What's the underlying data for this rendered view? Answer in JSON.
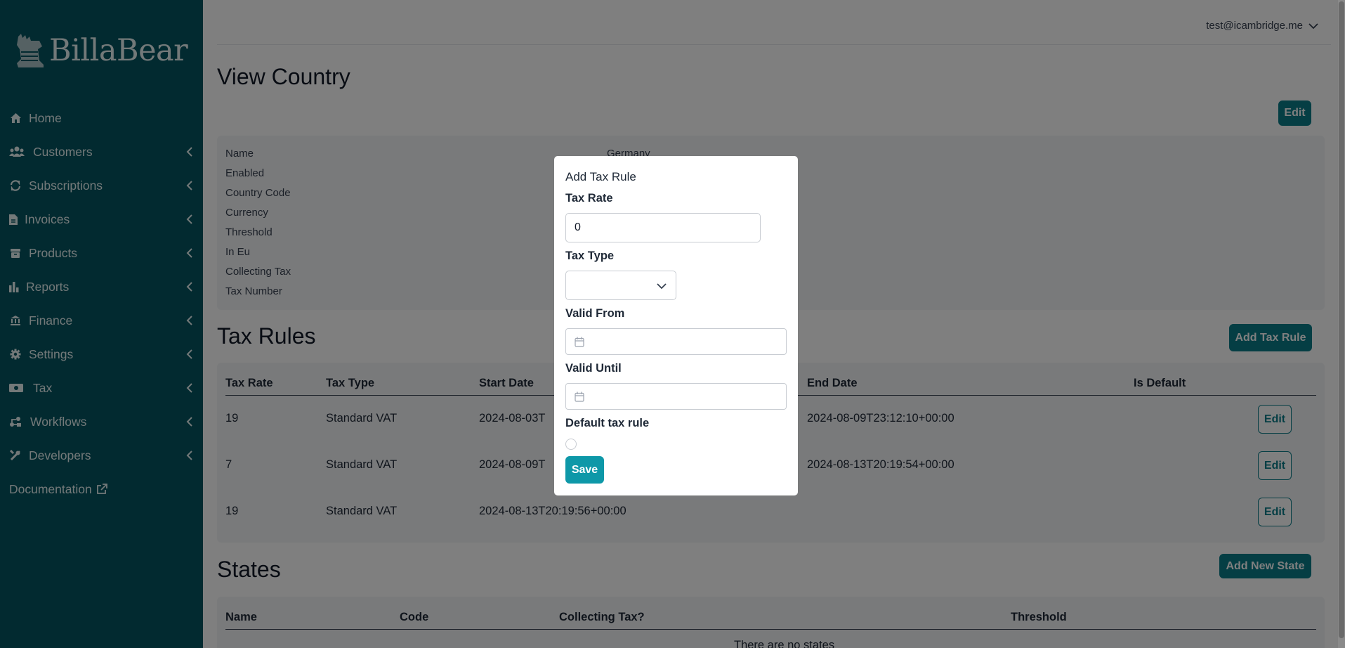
{
  "app": {
    "brand": "BillaBear"
  },
  "colors": {
    "sidebar": "#045561",
    "accent": "#0b7c89",
    "save_button": "#0e98a8"
  },
  "header": {
    "user_email": "test@icambridge.me"
  },
  "sidebar": {
    "items": [
      {
        "label": "Home",
        "icon": "home-icon"
      },
      {
        "label": "Customers",
        "icon": "users-icon"
      },
      {
        "label": "Subscriptions",
        "icon": "repeat-icon"
      },
      {
        "label": "Invoices",
        "icon": "file-invoice-icon"
      },
      {
        "label": "Products",
        "icon": "box-icon"
      },
      {
        "label": "Reports",
        "icon": "chart-icon"
      },
      {
        "label": "Finance",
        "icon": "bank-icon"
      },
      {
        "label": "Settings",
        "icon": "gear-icon"
      },
      {
        "label": "Tax",
        "icon": "money-icon"
      },
      {
        "label": "Workflows",
        "icon": "workflow-icon"
      },
      {
        "label": "Developers",
        "icon": "tools-icon"
      }
    ],
    "documentation": "Documentation"
  },
  "page": {
    "title": "View Country",
    "edit_button": "Edit"
  },
  "details": {
    "labels": [
      "Name",
      "Enabled",
      "Country Code",
      "Currency",
      "Threshold",
      "In Eu",
      "Collecting Tax",
      "Tax Number"
    ],
    "name_value": "Germany"
  },
  "tax_rules": {
    "title": "Tax Rules",
    "add_button": "Add Tax Rule",
    "columns": [
      "Tax Rate",
      "Tax Type",
      "Start Date",
      "End Date",
      "Is Default"
    ],
    "rows": [
      {
        "rate": "19",
        "type": "Standard VAT",
        "start": "2024-08-03T",
        "end": "2024-08-09T23:12:10+00:00",
        "action": "Edit"
      },
      {
        "rate": "7",
        "type": "Standard VAT",
        "start": "2024-08-09T",
        "end": "2024-08-13T20:19:54+00:00",
        "action": "Edit"
      },
      {
        "rate": "19",
        "type": "Standard VAT",
        "start": "2024-08-13T20:19:56+00:00",
        "end": "",
        "action": "Edit"
      }
    ]
  },
  "states": {
    "title": "States",
    "add_button": "Add New State",
    "columns": [
      "Name",
      "Code",
      "Collecting Tax?",
      "Threshold"
    ],
    "empty_text": "There are no states"
  },
  "modal": {
    "title": "Add Tax Rule",
    "tax_rate_label": "Tax Rate",
    "tax_rate_value": "0",
    "tax_type_label": "Tax Type",
    "tax_type_value": "",
    "valid_from_label": "Valid From",
    "valid_until_label": "Valid Until",
    "default_label": "Default tax rule",
    "default_checked": false,
    "save_button": "Save"
  }
}
